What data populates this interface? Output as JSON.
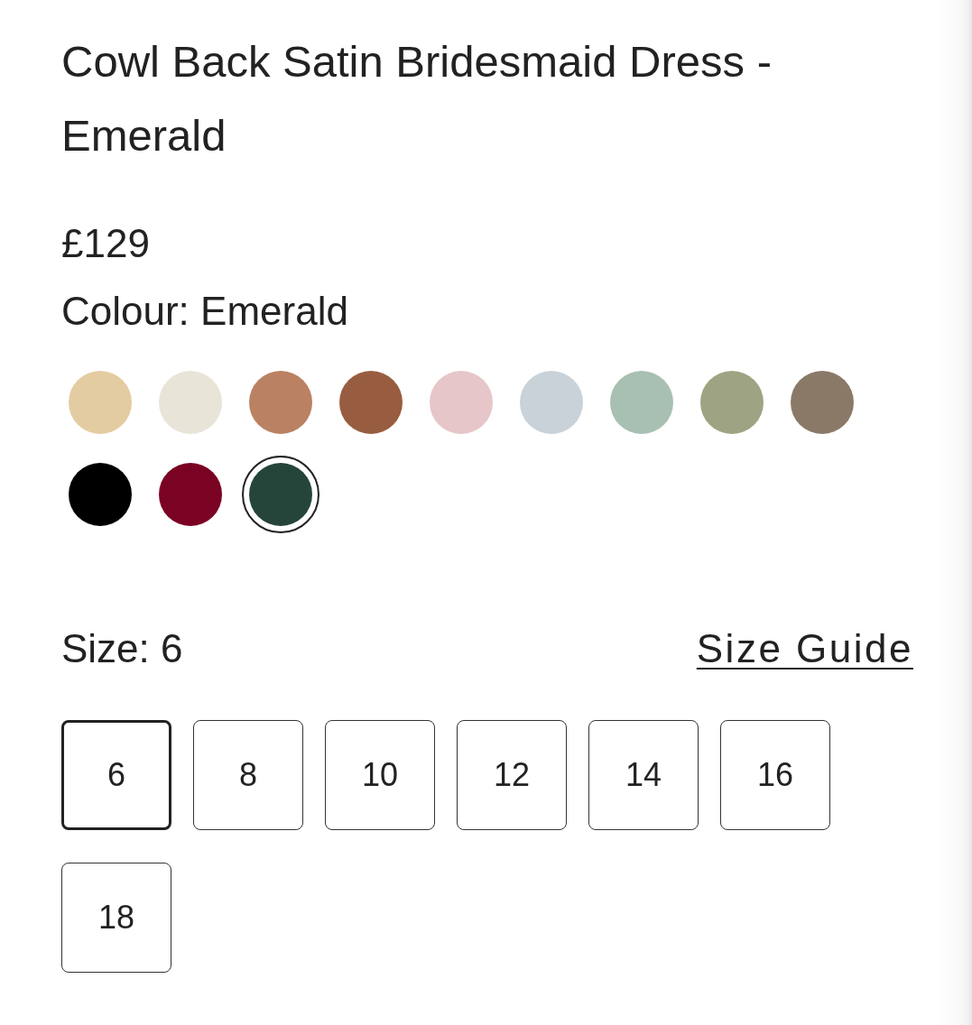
{
  "product": {
    "title": "Cowl Back Satin Bridesmaid Dress - Emerald",
    "price": "£129"
  },
  "colour": {
    "label": "Colour: Emerald",
    "swatches": [
      {
        "color": "#e3cca1",
        "selected": false
      },
      {
        "color": "#e8e4d8",
        "selected": false
      },
      {
        "color": "#bb8163",
        "selected": false
      },
      {
        "color": "#985d40",
        "selected": false
      },
      {
        "color": "#e6c6c8",
        "selected": false
      },
      {
        "color": "#c9d2d8",
        "selected": false
      },
      {
        "color": "#a8c0b1",
        "selected": false
      },
      {
        "color": "#9ea483",
        "selected": false
      },
      {
        "color": "#8b7968",
        "selected": false
      },
      {
        "color": "#000000",
        "selected": false
      },
      {
        "color": "#7a0223",
        "selected": false
      },
      {
        "color": "#25453a",
        "selected": true
      }
    ]
  },
  "size": {
    "label": "Size: 6",
    "guide_link": "Size Guide",
    "options": [
      {
        "label": "6",
        "selected": true
      },
      {
        "label": "8",
        "selected": false
      },
      {
        "label": "10",
        "selected": false
      },
      {
        "label": "12",
        "selected": false
      },
      {
        "label": "14",
        "selected": false
      },
      {
        "label": "16",
        "selected": false
      },
      {
        "label": "18",
        "selected": false
      }
    ]
  }
}
